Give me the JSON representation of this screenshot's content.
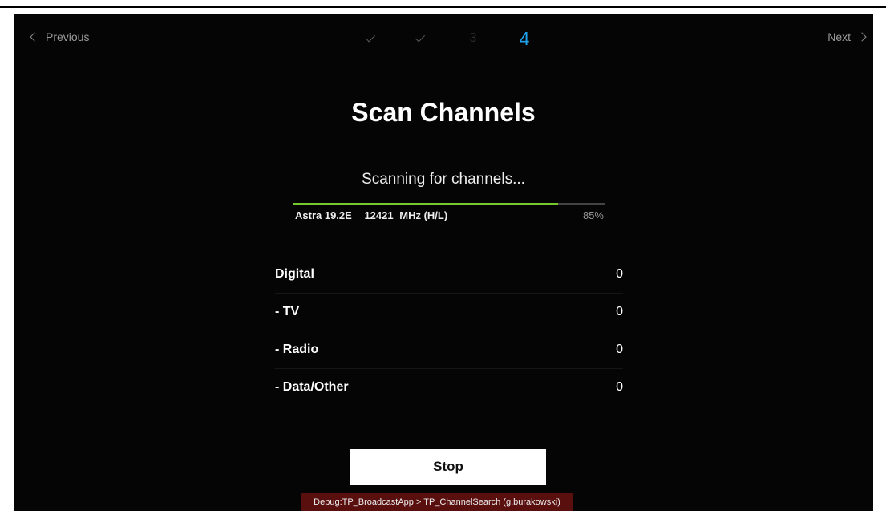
{
  "nav": {
    "previous_label": "Previous",
    "next_label": "Next"
  },
  "steps": [
    {
      "state": "done"
    },
    {
      "state": "done"
    },
    {
      "state": "pending",
      "label": "3"
    },
    {
      "state": "current",
      "label": "4"
    }
  ],
  "page": {
    "title": "Scan Channels",
    "status": "Scanning for channels..."
  },
  "scan": {
    "satellite": "Astra 19.2E",
    "frequency": "12421",
    "unit_pol": "MHz (H/L)",
    "progress_percent": 85,
    "progress_text": "85%"
  },
  "results": [
    {
      "label": "Digital",
      "count": "0"
    },
    {
      "label": "- TV",
      "count": "0"
    },
    {
      "label": "- Radio",
      "count": "0"
    },
    {
      "label": "- Data/Other",
      "count": "0"
    }
  ],
  "actions": {
    "stop_label": "Stop"
  },
  "debug": {
    "text": "Debug:TP_BroadcastApp > TP_ChannelSearch (g.burakowski)"
  },
  "colors": {
    "accent": "#1ea3f0",
    "progress": "#76c82f",
    "background": "#050505"
  }
}
